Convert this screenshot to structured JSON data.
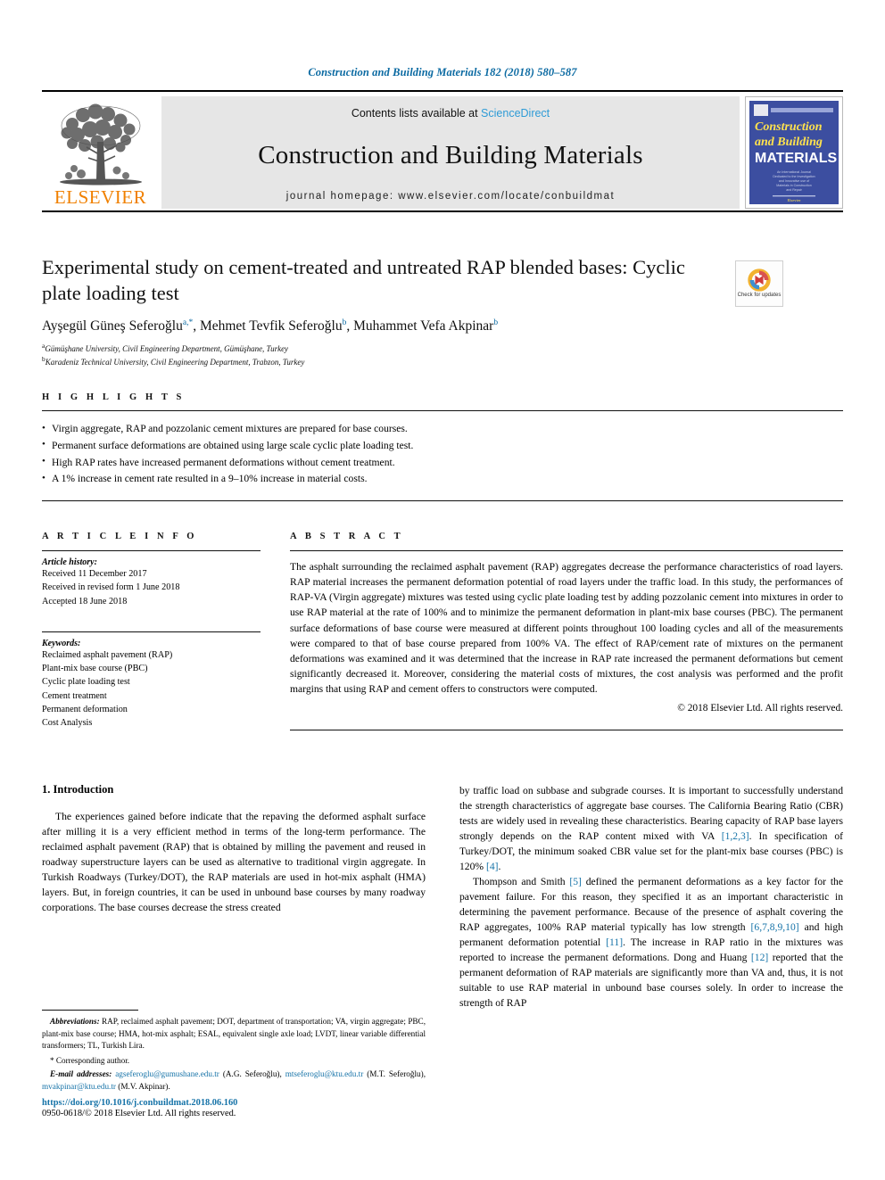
{
  "running_head": "Construction and Building Materials 182 (2018) 580–587",
  "masthead": {
    "publisher_name": "ELSEVIER",
    "contents_prefix": "Contents lists available at ",
    "sciencedirect": "ScienceDirect",
    "journal_title": "Construction and Building Materials",
    "homepage": "journal homepage: www.elsevier.com/locate/conbuildmat",
    "cover": {
      "line1": "Construction",
      "line2": "and Building",
      "line3": "MATERIALS",
      "blurb": "An International Journal Dedicated to the Investigation and Innovative use of Materials in Construction and Repair"
    }
  },
  "title_block": {
    "title": "Experimental study on cement-treated and untreated RAP blended bases: Cyclic plate loading test",
    "authors": [
      {
        "name": "Ayşegül Güneş Seferoğlu",
        "marks": "a,*"
      },
      {
        "name": "Mehmet Tevfik Seferoğlu",
        "marks": "b"
      },
      {
        "name": "Muhammet Vefa Akpinar",
        "marks": "b"
      }
    ],
    "affiliations": [
      {
        "mark": "a",
        "text": "Gümüşhane University, Civil Engineering Department, Gümüşhane, Turkey"
      },
      {
        "mark": "b",
        "text": "Karadeniz Technical University, Civil Engineering Department, Trabzon, Turkey"
      }
    ],
    "crossmark_label": "Check for updates"
  },
  "highlights": {
    "heading": "H I G H L I G H T S",
    "items": [
      "Virgin aggregate, RAP and pozzolanic cement mixtures are prepared for base courses.",
      "Permanent surface deformations are obtained using large scale cyclic plate loading test.",
      "High RAP rates have increased permanent deformations without cement treatment.",
      "A 1% increase in cement rate resulted in a 9–10% increase in material costs."
    ]
  },
  "article_info": {
    "heading": "A R T I C L E    I N F O",
    "history_label": "Article history:",
    "history": [
      "Received 11 December 2017",
      "Received in revised form 1 June 2018",
      "Accepted 18 June 2018"
    ],
    "keywords_label": "Keywords:",
    "keywords": [
      "Reclaimed asphalt pavement (RAP)",
      "Plant-mix base course (PBC)",
      "Cyclic plate loading test",
      "Cement treatment",
      "Permanent deformation",
      "Cost Analysis"
    ]
  },
  "abstract": {
    "heading": "A B S T R A C T",
    "text": "The asphalt surrounding the reclaimed asphalt pavement (RAP) aggregates decrease the performance characteristics of road layers. RAP material increases the permanent deformation potential of road layers under the traffic load. In this study, the performances of RAP-VA (Virgin aggregate) mixtures was tested using cyclic plate loading test by adding pozzolanic cement into mixtures in order to use RAP material at the rate of 100% and to minimize the permanent deformation in plant-mix base courses (PBC). The permanent surface deformations of base course were measured at different points throughout 100 loading cycles and all of the measurements were compared to that of base course prepared from 100% VA. The effect of RAP/cement rate of mixtures on the permanent deformations was examined and it was determined that the increase in RAP rate increased the permanent deformations but cement significantly decreased it. Moreover, considering the material costs of mixtures, the cost analysis was performed and the profit margins that using RAP and cement offers to constructors were computed.",
    "copyright": "© 2018 Elsevier Ltd. All rights reserved."
  },
  "body": {
    "section_heading": "1. Introduction",
    "left_paragraph": "The experiences gained before indicate that the repaving the deformed asphalt surface after milling it is a very efficient method in terms of the long-term performance. The reclaimed asphalt pavement (RAP) that is obtained by milling the pavement and reused in roadway superstructure layers can be used as alternative to traditional virgin aggregate. In Turkish Roadways (Turkey/DOT), the RAP materials are used in hot-mix asphalt (HMA) layers. But, in foreign countries, it can be used in unbound base courses by many roadway corporations. The base courses decrease the stress created",
    "right_paragraph_1_a": "by traffic load on subbase and subgrade courses. It is important to successfully understand the strength characteristics of aggregate base courses. The California Bearing Ratio (CBR) tests are widely used in revealing these characteristics. Bearing capacity of RAP base layers strongly depends on the RAP content mixed with VA ",
    "ref_123": "[1,2,3]",
    "right_paragraph_1_b": ". In specification of Turkey/DOT, the minimum soaked CBR value set for the plant-mix base courses (PBC) is 120% ",
    "ref_4": "[4]",
    "right_paragraph_1_c": ".",
    "right_paragraph_2_a": "Thompson and Smith ",
    "ref_5": "[5]",
    "right_paragraph_2_b": " defined the permanent deformations as a key factor for the pavement failure. For this reason, they specified it as an important characteristic in determining the pavement performance. Because of the presence of asphalt covering the RAP aggregates, 100% RAP material typically has low strength ",
    "ref_678910": "[6,7,8,9,10]",
    "right_paragraph_2_c": " and high permanent deformation potential ",
    "ref_11": "[11]",
    "right_paragraph_2_d": ". The increase in RAP ratio in the mixtures was reported to increase the permanent deformations. Dong and Huang ",
    "ref_12": "[12]",
    "right_paragraph_2_e": " reported that the permanent deformation of RAP materials are significantly more than VA and, thus, it is not suitable to use RAP material in unbound base courses solely. In order to increase the strength of RAP"
  },
  "footnotes": {
    "abbreviations_label": "Abbreviations:",
    "abbreviations_text": " RAP, reclaimed asphalt pavement; DOT, department of transportation; VA, virgin aggregate; PBC, plant-mix base course; HMA, hot-mix asphalt; ESAL, equivalent single axle load; LVDT, linear variable differential transformers; TL, Turkish Lira.",
    "corresponding": "* Corresponding author.",
    "email_label": "E-mail addresses:",
    "emails": [
      {
        "address": "agseferoglu@gumushane.edu.tr",
        "owner": " (A.G. Seferoğlu), "
      },
      {
        "address": "mtseferoglu@ktu.edu.tr",
        "owner": " (M.T. Seferoğlu), "
      },
      {
        "address": "mvakpinar@ktu.edu.tr",
        "owner": " (M.V. Akpinar)."
      }
    ]
  },
  "doi_block": {
    "doi": "https://doi.org/10.1016/j.conbuildmat.2018.06.160",
    "issn": "0950-0618/© 2018 Elsevier Ltd. All rights reserved."
  }
}
